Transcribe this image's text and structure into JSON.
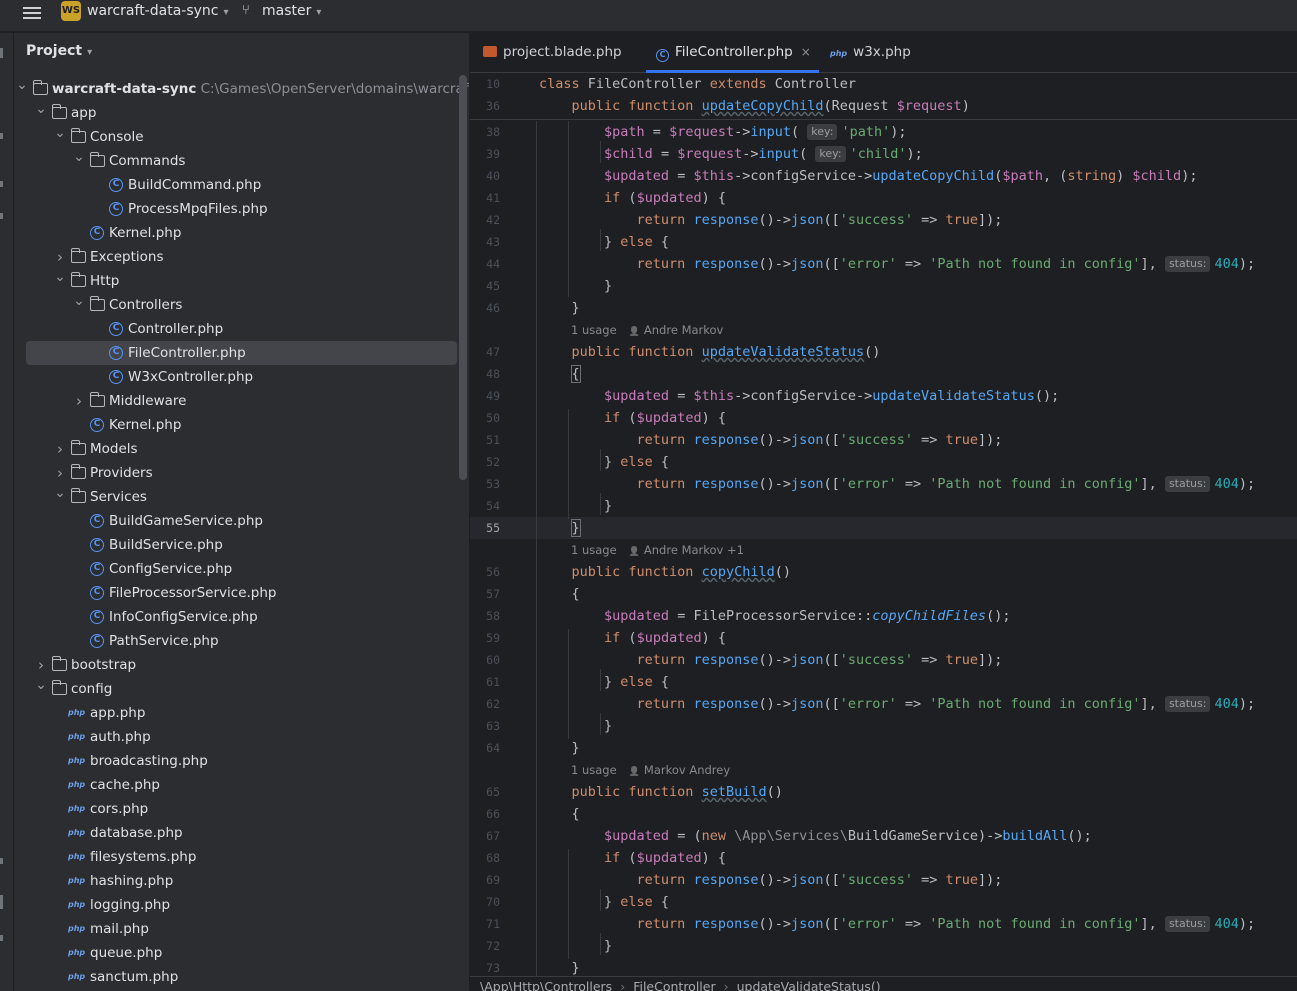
{
  "titlebar": {
    "project_badge": "WS",
    "project_name": "warcraft-data-sync",
    "branch": "master"
  },
  "panel": {
    "title": "Project",
    "tree": [
      {
        "depth": 0,
        "kind": "folder",
        "open": true,
        "label": "warcraft-data-sync",
        "path": "C:\\Games\\OpenServer\\domains\\warcraft-da",
        "bold": true
      },
      {
        "depth": 1,
        "kind": "folder",
        "open": true,
        "label": "app"
      },
      {
        "depth": 2,
        "kind": "folder",
        "open": true,
        "label": "Console"
      },
      {
        "depth": 3,
        "kind": "folder",
        "open": true,
        "label": "Commands"
      },
      {
        "depth": 4,
        "kind": "class",
        "label": "BuildCommand.php"
      },
      {
        "depth": 4,
        "kind": "class",
        "label": "ProcessMpqFiles.php"
      },
      {
        "depth": 3,
        "kind": "class",
        "label": "Kernel.php"
      },
      {
        "depth": 2,
        "kind": "folder",
        "open": false,
        "label": "Exceptions"
      },
      {
        "depth": 2,
        "kind": "folder",
        "open": true,
        "label": "Http"
      },
      {
        "depth": 3,
        "kind": "folder",
        "open": true,
        "label": "Controllers"
      },
      {
        "depth": 4,
        "kind": "class",
        "label": "Controller.php"
      },
      {
        "depth": 4,
        "kind": "class",
        "label": "FileController.php",
        "selected": true
      },
      {
        "depth": 4,
        "kind": "class",
        "label": "W3xController.php"
      },
      {
        "depth": 3,
        "kind": "folder",
        "open": false,
        "label": "Middleware"
      },
      {
        "depth": 3,
        "kind": "class",
        "label": "Kernel.php"
      },
      {
        "depth": 2,
        "kind": "folder",
        "open": false,
        "label": "Models"
      },
      {
        "depth": 2,
        "kind": "folder",
        "open": false,
        "label": "Providers"
      },
      {
        "depth": 2,
        "kind": "folder",
        "open": true,
        "label": "Services"
      },
      {
        "depth": 3,
        "kind": "class",
        "label": "BuildGameService.php"
      },
      {
        "depth": 3,
        "kind": "class",
        "label": "BuildService.php"
      },
      {
        "depth": 3,
        "kind": "class",
        "label": "ConfigService.php"
      },
      {
        "depth": 3,
        "kind": "class",
        "label": "FileProcessorService.php"
      },
      {
        "depth": 3,
        "kind": "class",
        "label": "InfoConfigService.php"
      },
      {
        "depth": 3,
        "kind": "class",
        "label": "PathService.php"
      },
      {
        "depth": 1,
        "kind": "folder",
        "open": false,
        "label": "bootstrap"
      },
      {
        "depth": 1,
        "kind": "folder",
        "open": true,
        "label": "config"
      },
      {
        "depth": 2,
        "kind": "php",
        "label": "app.php"
      },
      {
        "depth": 2,
        "kind": "php",
        "label": "auth.php"
      },
      {
        "depth": 2,
        "kind": "php",
        "label": "broadcasting.php"
      },
      {
        "depth": 2,
        "kind": "php",
        "label": "cache.php"
      },
      {
        "depth": 2,
        "kind": "php",
        "label": "cors.php"
      },
      {
        "depth": 2,
        "kind": "php",
        "label": "database.php"
      },
      {
        "depth": 2,
        "kind": "php",
        "label": "filesystems.php"
      },
      {
        "depth": 2,
        "kind": "php",
        "label": "hashing.php"
      },
      {
        "depth": 2,
        "kind": "php",
        "label": "logging.php"
      },
      {
        "depth": 2,
        "kind": "php",
        "label": "mail.php"
      },
      {
        "depth": 2,
        "kind": "php",
        "label": "queue.php"
      },
      {
        "depth": 2,
        "kind": "php",
        "label": "sanctum.php"
      }
    ]
  },
  "tabs": [
    {
      "label": "project.blade.php",
      "icon": "blade-file-icon"
    },
    {
      "label": "FileController.php",
      "icon": "php-class-icon",
      "active": true,
      "close": "×"
    },
    {
      "label": "w3x.php",
      "icon": "php-file-icon",
      "icon_text": "php"
    }
  ],
  "tree_icon_text": {
    "class": "C",
    "php": "php"
  },
  "code": {
    "sticky": [
      {
        "n": "10",
        "html": "<span class='kw'>class</span> FileController <span class='kw'>extends</span> Controller"
      },
      {
        "n": "36",
        "html": "    <span class='kw'>public function</span> <span class='fnu'>updateCopyChild</span>(Request <span class='var'>$request</span>)"
      }
    ],
    "lines": [
      {
        "n": "38",
        "html": "        <span class='var'>$path</span> = <span class='var'>$request</span>-><span class='fn'>input</span>( <span class='hint'>key:</span><span class='str'>'path'</span>);"
      },
      {
        "n": "39",
        "html": "        <span class='var'>$child</span> = <span class='var'>$request</span>-><span class='fn'>input</span>( <span class='hint'>key:</span><span class='str'>'child'</span>);"
      },
      {
        "n": "40",
        "html": "        <span class='var'>$updated</span> = <span class='var'>$this</span>->configService-><span class='fn'>updateCopyChild</span>(<span class='var'>$path</span>, (<span class='kw'>string</span>) <span class='var'>$child</span>);"
      },
      {
        "n": "41",
        "html": "        <span class='kw'>if</span> (<span class='var'>$updated</span>) {"
      },
      {
        "n": "42",
        "html": "            <span class='kw'>return</span> <span class='fn'>response</span>()-><span class='fn'>json</span>([<span class='str'>'success'</span> => <span class='kw'>true</span>]);"
      },
      {
        "n": "43",
        "html": "        } <span class='kw'>else</span> {"
      },
      {
        "n": "44",
        "html": "            <span class='kw'>return</span> <span class='fn'>response</span>()-><span class='fn'>json</span>([<span class='str'>'error'</span> => <span class='str'>'Path not found in config'</span>], <span class='hint'>status:</span><span class='num'>404</span>);"
      },
      {
        "n": "45",
        "html": "        }"
      },
      {
        "n": "46",
        "html": "    }"
      },
      {
        "hint": "1 usage",
        "author": "Andre Markov"
      },
      {
        "n": "47",
        "html": "    <span class='kw'>public function</span> <span class='fnu'>updateValidateStatus</span>()"
      },
      {
        "n": "48",
        "html": "    <span class='brace-hl'>{</span>"
      },
      {
        "n": "49",
        "html": "        <span class='var'>$updated</span> = <span class='var'>$this</span>->configService-><span class='fn'>updateValidateStatus</span>();"
      },
      {
        "n": "50",
        "html": "        <span class='kw'>if</span> (<span class='var'>$updated</span>) {"
      },
      {
        "n": "51",
        "html": "            <span class='kw'>return</span> <span class='fn'>response</span>()-><span class='fn'>json</span>([<span class='str'>'success'</span> => <span class='kw'>true</span>]);"
      },
      {
        "n": "52",
        "html": "        } <span class='kw'>else</span> {"
      },
      {
        "n": "53",
        "html": "            <span class='kw'>return</span> <span class='fn'>response</span>()-><span class='fn'>json</span>([<span class='str'>'error'</span> => <span class='str'>'Path not found in config'</span>], <span class='hint'>status:</span><span class='num'>404</span>);"
      },
      {
        "n": "54",
        "html": "        }"
      },
      {
        "n": "55",
        "html": "    <span class='brace-hl'>}</span>",
        "current": true
      },
      {
        "hint": "1 usage",
        "author": "Andre Markov +1"
      },
      {
        "n": "56",
        "html": "    <span class='kw'>public function</span> <span class='fnu'>copyChild</span>()"
      },
      {
        "n": "57",
        "html": "    {"
      },
      {
        "n": "58",
        "html": "        <span class='var'>$updated</span> = FileProcessorService::<span class='it'>copyChildFiles</span>();"
      },
      {
        "n": "59",
        "html": "        <span class='kw'>if</span> (<span class='var'>$updated</span>) {"
      },
      {
        "n": "60",
        "html": "            <span class='kw'>return</span> <span class='fn'>response</span>()-><span class='fn'>json</span>([<span class='str'>'success'</span> => <span class='kw'>true</span>]);"
      },
      {
        "n": "61",
        "html": "        } <span class='kw'>else</span> {"
      },
      {
        "n": "62",
        "html": "            <span class='kw'>return</span> <span class='fn'>response</span>()-><span class='fn'>json</span>([<span class='str'>'error'</span> => <span class='str'>'Path not found in config'</span>], <span class='hint'>status:</span><span class='num'>404</span>);"
      },
      {
        "n": "63",
        "html": "        }"
      },
      {
        "n": "64",
        "html": "    }"
      },
      {
        "hint": "1 usage",
        "author": "Markov Andrey"
      },
      {
        "n": "65",
        "html": "    <span class='kw'>public function</span> <span class='fnu'>setBuild</span>()"
      },
      {
        "n": "66",
        "html": "    {"
      },
      {
        "n": "67",
        "html": "        <span class='var'>$updated</span> = (<span class='kw'>new</span> <span class='ns'>\\App\\Services\\</span>BuildGameService)-><span class='fn'>buildAll</span>();"
      },
      {
        "n": "68",
        "html": "        <span class='kw'>if</span> (<span class='var'>$updated</span>) {"
      },
      {
        "n": "69",
        "html": "            <span class='kw'>return</span> <span class='fn'>response</span>()-><span class='fn'>json</span>([<span class='str'>'success'</span> => <span class='kw'>true</span>]);"
      },
      {
        "n": "70",
        "html": "        } <span class='kw'>else</span> {"
      },
      {
        "n": "71",
        "html": "            <span class='kw'>return</span> <span class='fn'>response</span>()-><span class='fn'>json</span>([<span class='str'>'error'</span> => <span class='str'>'Path not found in config'</span>], <span class='hint'>status:</span><span class='num'>404</span>);"
      },
      {
        "n": "72",
        "html": "        }"
      },
      {
        "n": "73",
        "html": "    }"
      }
    ]
  },
  "breadcrumb": [
    "\\App\\Http\\Controllers",
    "FileController",
    "updateValidateStatus()"
  ],
  "breadcrumb_sep": "›"
}
